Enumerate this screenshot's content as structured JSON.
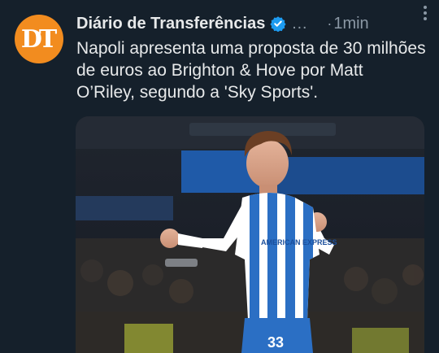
{
  "account": {
    "avatar_initials": "DT",
    "display_name": "Diário de Transferências",
    "handle_truncated": "…",
    "separator": "·",
    "timestamp": "1min"
  },
  "tweet": {
    "text": "Napoli apresenta uma proposta de 30 milhões de euros ao Brighton & Hove por Matt O’Riley, segundo a 'Sky Sports'."
  },
  "media": {
    "banner_text": "AMERICAN EXPRESS",
    "shirt_number": "33"
  },
  "colors": {
    "background": "#15202b",
    "avatar": "#f28c1f",
    "verified": "#1d9bf0",
    "secondary_text": "#8b98a5"
  },
  "icons": {
    "verified": "verified-badge-icon",
    "more": "more-options-icon"
  }
}
